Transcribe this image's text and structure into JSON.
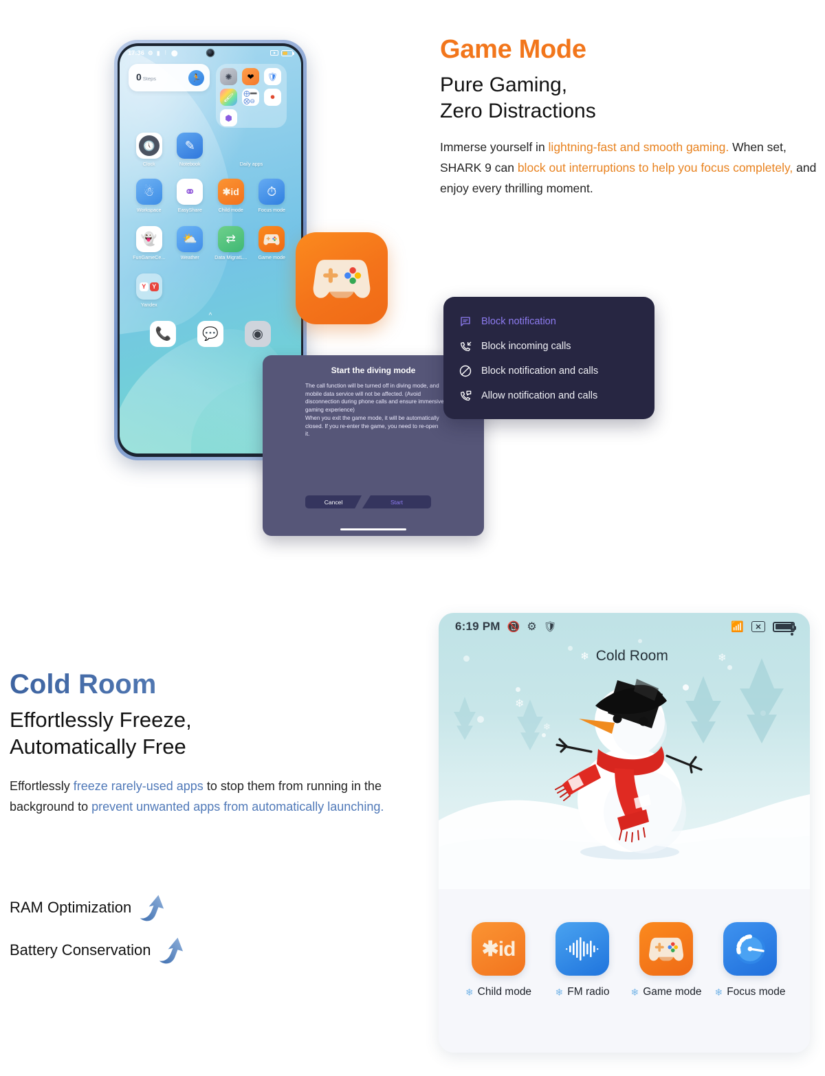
{
  "game_section": {
    "title": "Game Mode",
    "subtitle_line1": "Pure Gaming,",
    "subtitle_line2": "Zero Distractions",
    "body": {
      "p1": "Immerse yourself in ",
      "h1": "lightning-fast and smooth gaming.",
      "p2": " When set, SHARK 9 can ",
      "h2": "block out interruptions to help you focus completely,",
      "p3": " and enjoy every thrilling moment."
    },
    "accent_color": "#F2761B"
  },
  "phone": {
    "status_bar": {
      "time": "17:36",
      "icons": [
        "gear-icon",
        "battery-saver-icon",
        "sim-icon",
        "shield-icon"
      ],
      "right_icons": [
        "screen-record-icon",
        "battery-icon"
      ]
    },
    "widget": {
      "value": "0",
      "label": "Steps",
      "icon": "running-person-icon"
    },
    "folder": {
      "label": "Daily apps",
      "icons": [
        "compass-icon",
        "health-heart-icon",
        "security-shield-icon",
        "theme-brush-icon",
        "calculator-icon",
        "music-record-icon",
        "gallery-hex-icon"
      ]
    },
    "apps_row1": [
      {
        "label": "Clock",
        "icon": "clock-icon"
      },
      {
        "label": "Notebook",
        "icon": "notebook-pen-icon"
      }
    ],
    "apps_row2": [
      {
        "label": "Workspace",
        "icon": "workspace-icon"
      },
      {
        "label": "EasyShare",
        "icon": "easyshare-icon"
      },
      {
        "label": "Child mode",
        "icon": "child-mode-icon"
      },
      {
        "label": "Focus mode",
        "icon": "focus-mode-icon"
      }
    ],
    "apps_row3": [
      {
        "label": "FunGameCe...",
        "icon": "fungamecenter-icon"
      },
      {
        "label": "Weather",
        "icon": "weather-icon"
      },
      {
        "label": "Data MigratL...",
        "icon": "data-migration-icon"
      },
      {
        "label": "Game mode",
        "icon": "game-mode-icon"
      }
    ],
    "apps_row4": [
      {
        "label": "Yandex",
        "icon": "yandex-icon"
      }
    ],
    "dock": [
      "phone-icon",
      "messages-icon",
      "camera-icon"
    ],
    "drawer_handle": "chevron-up-icon"
  },
  "notification_menu": {
    "items": [
      {
        "label": "Block notification",
        "icon": "message-block-icon",
        "active": true
      },
      {
        "label": "Block incoming calls",
        "icon": "call-incoming-icon",
        "active": false
      },
      {
        "label": "Block notification and calls",
        "icon": "no-entry-icon",
        "active": false
      },
      {
        "label": "Allow notification and calls",
        "icon": "call-message-icon",
        "active": false
      }
    ],
    "active_color": "#8d7bf0",
    "background": "#272642"
  },
  "diving_dialog": {
    "title": "Start the diving mode",
    "body_line1": "The call function will be turned off in diving mode, and mobile data service will not be affected. (Avoid disconnection during phone calls and ensure immersive gaming experience)",
    "body_line2": "When you exit the game mode, it will be automatically closed. If you re-enter the game, you need to re-open it.",
    "cancel_label": "Cancel",
    "start_label": "Start"
  },
  "cold_section": {
    "title": "Cold Room",
    "subtitle_line1": "Effortlessly Freeze,",
    "subtitle_line2": "Automatically Free",
    "body": {
      "p1": "Effortlessly ",
      "h1": "freeze rarely-used apps",
      "p2": " to stop them from running in the background to ",
      "h2": "prevent unwanted apps from automatically launching."
    },
    "accent_color": "#5079b8",
    "kpis": [
      {
        "label": "RAM Optimization",
        "icon": "up-arrow-icon"
      },
      {
        "label": "Battery Conservation",
        "icon": "up-arrow-icon"
      }
    ]
  },
  "cold_panel": {
    "status_bar": {
      "time": "6:19 PM",
      "icons": [
        "vibrate-icon",
        "gear-icon",
        "shield-play-icon"
      ],
      "right_icons": [
        "wifi-icon",
        "no-sim-icon",
        "battery-icon"
      ]
    },
    "title": "Cold Room",
    "title_icon": "snowflake-icon",
    "overflow_icon": "more-vertical-icon",
    "illustration": "snowman-winter-scene",
    "frozen_apps": [
      {
        "label": "Child mode",
        "icon": "child-mode-icon",
        "badge": "snowflake-icon"
      },
      {
        "label": "FM radio",
        "icon": "fm-radio-icon",
        "badge": "snowflake-icon"
      },
      {
        "label": "Game mode",
        "icon": "game-mode-icon",
        "badge": "snowflake-icon"
      },
      {
        "label": "Focus mode",
        "icon": "focus-mode-icon",
        "badge": "snowflake-icon"
      }
    ]
  }
}
